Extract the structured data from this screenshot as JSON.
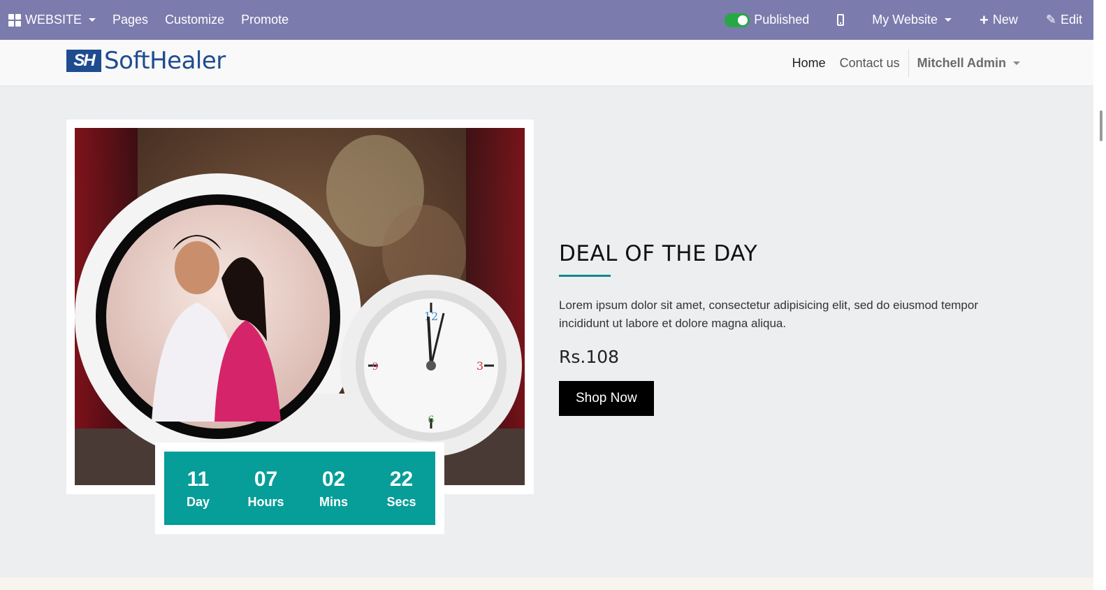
{
  "admin_bar": {
    "website_label": "WEBSITE",
    "pages_label": "Pages",
    "customize_label": "Customize",
    "promote_label": "Promote",
    "published_label": "Published",
    "my_website_label": "My Website",
    "new_label": "New",
    "edit_label": "Edit"
  },
  "site": {
    "logo_mark": "SH",
    "logo_text": "SoftHealer",
    "nav": {
      "home": "Home",
      "contact": "Contact us",
      "user": "Mitchell Admin"
    }
  },
  "countdown": [
    {
      "value": "11",
      "label": "Day"
    },
    {
      "value": "07",
      "label": "Hours"
    },
    {
      "value": "02",
      "label": "Mins"
    },
    {
      "value": "22",
      "label": "Secs"
    }
  ],
  "deal": {
    "title": "DEAL OF THE DAY",
    "description": "Lorem ipsum dolor sit amet, consectetur adipisicing elit, sed do eiusmod tempor incididunt ut labore et dolore magna aliqua.",
    "price": "Rs.108",
    "button": "Shop Now"
  },
  "colors": {
    "admin_bar": "#7c7bad",
    "accent": "#079d98",
    "toggle_on": "#28a745",
    "logo": "#1f4c8f"
  }
}
